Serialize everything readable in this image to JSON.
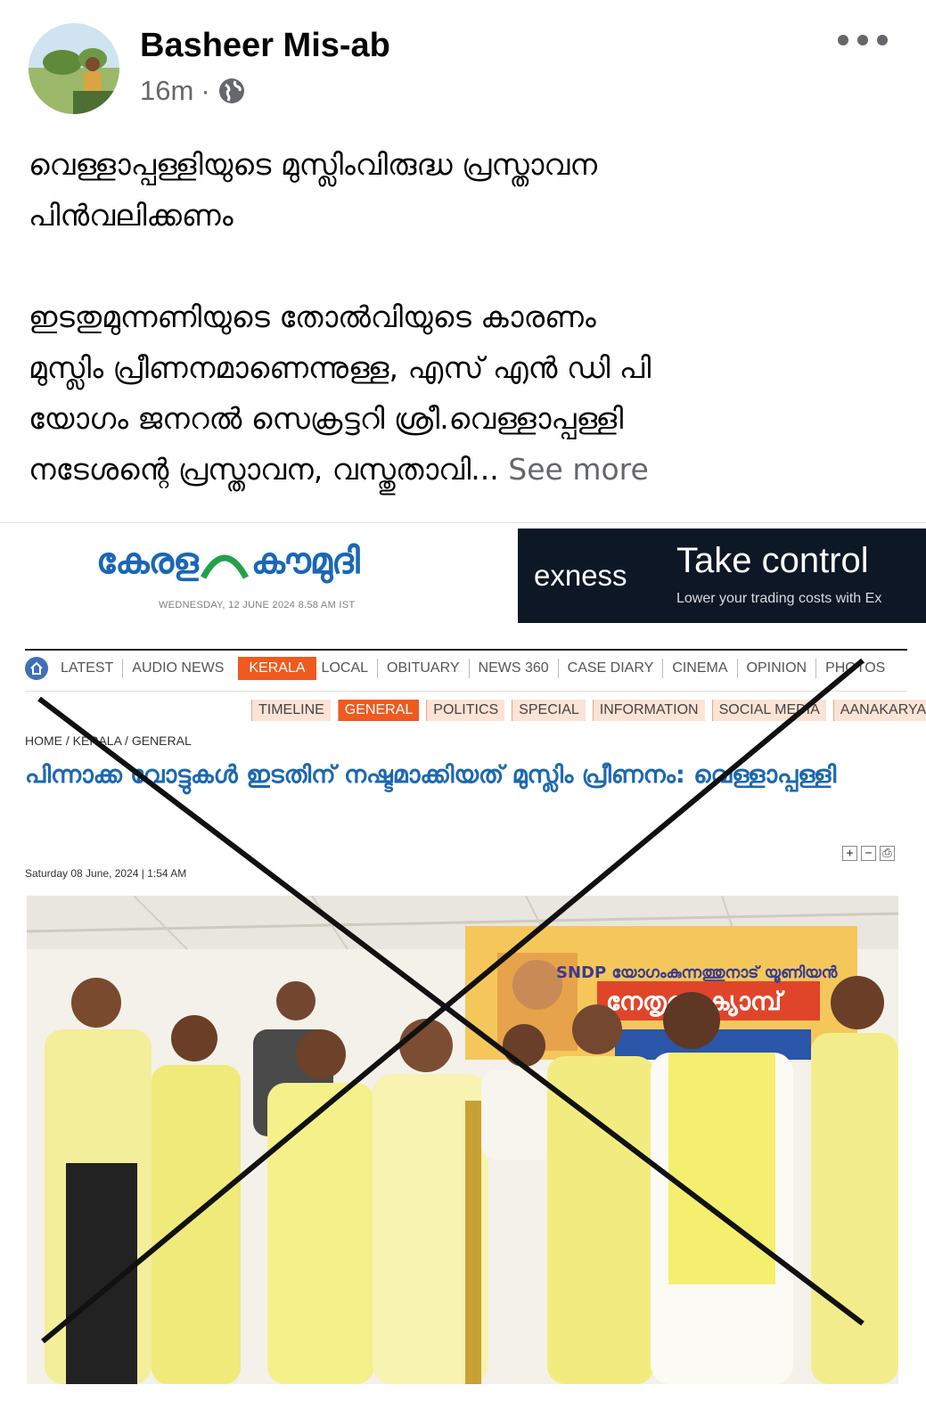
{
  "post": {
    "author": "Basheer Mis-ab",
    "time": "16m",
    "separator": "·",
    "privacy_icon": "globe-icon",
    "menu_icon": "more-horizontal-icon",
    "text_line_1": "വെള്ളാപ്പള്ളിയുടെ മുസ്ലിംവിരുദ്ധ പ്രസ്താവന",
    "text_line_2": "പിൻവലിക്കണം",
    "text_line_3": "ഇടതുമുന്നണിയുടെ തോൽവിയുടെ കാരണം",
    "text_line_4": "മുസ്ലിം പ്രീണനമാണെന്നുള്ള, എസ് എൻ ഡി പി",
    "text_line_5": "യോഗം ജനറൽ സെക്രട്ടറി ശ്രീ.വെള്ളാപ്പള്ളി",
    "text_line_6": "നടേശന്റെ പ്രസ്താവന, വസ്തുതാവി...",
    "see_more": "See more"
  },
  "screenshot": {
    "logo_left": "കേരള",
    "logo_right": "കൗമുദി",
    "paper_date": "WEDNESDAY, 12 JUNE 2024 8.58 AM IST",
    "ad": {
      "brand": "exness",
      "title": "Take control",
      "subtitle": "Lower your trading costs with Ex"
    },
    "nav_main": [
      "LATEST",
      "AUDIO NEWS",
      "KERALA",
      "LOCAL",
      "OBITUARY",
      "NEWS 360",
      "CASE DIARY",
      "CINEMA",
      "OPINION",
      "PHOTOS"
    ],
    "nav_main_active": "KERALA",
    "nav_sub": [
      "TIMELINE",
      "GENERAL",
      "POLITICS",
      "SPECIAL",
      "INFORMATION",
      "SOCIAL MEDIA",
      "AANAKARYA"
    ],
    "nav_sub_active": "GENERAL",
    "breadcrumb": "HOME / KERALA / GENERAL",
    "headline": "പിന്നാക്ക വോട്ടുകൾ ഇടതിന് നഷ്ടമാക്കിയത് മുസ്ലിം പ്രീണനം: വെള്ളാപ്പള്ളി",
    "font_tools": [
      "+",
      "−",
      "⎙"
    ],
    "article_date": "Saturday 08 June, 2024 | 1:54 AM",
    "banner_text": "SNDP യോഗംകുന്നത്തുനാട് യൂണിയൻ",
    "banner_title": "നേതൃത്വ ക്യാമ്പ്",
    "accent": "#ef5a1f",
    "link_blue": "#1d68b0"
  }
}
